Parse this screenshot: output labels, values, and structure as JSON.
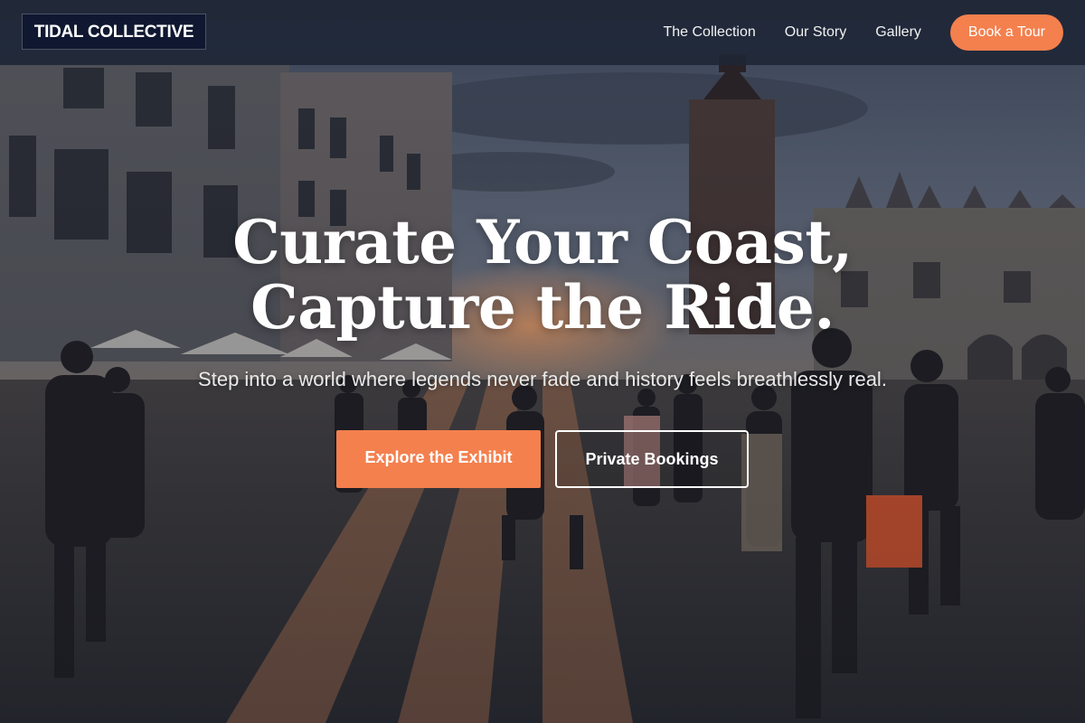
{
  "brand": {
    "logo_text": "TIDAL COLLECTIVE"
  },
  "nav": {
    "links": [
      "The Collection",
      "Our Story",
      "Gallery"
    ],
    "cta_label": "Book a Tour"
  },
  "hero": {
    "headline_line1": "Curate Your Coast,",
    "headline_line2": "Capture the Ride.",
    "subheadline": "Step into a world where legends never fade and history feels breathlessly real.",
    "primary_button": "Explore the Exhibit",
    "secondary_button": "Private Bookings",
    "background_image": "city-square-dusk-photo"
  },
  "colors": {
    "accent": "#f4804e",
    "nav_background": "#1e2636",
    "logo_background": "#0f1830",
    "text_light": "#ffffff"
  }
}
